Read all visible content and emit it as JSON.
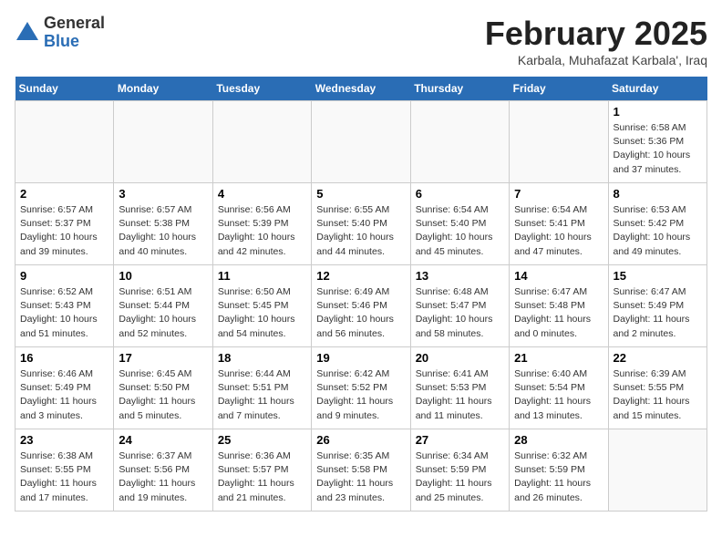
{
  "header": {
    "logo_general": "General",
    "logo_blue": "Blue",
    "title": "February 2025",
    "subtitle": "Karbala, Muhafazat Karbala', Iraq"
  },
  "days_of_week": [
    "Sunday",
    "Monday",
    "Tuesday",
    "Wednesday",
    "Thursday",
    "Friday",
    "Saturday"
  ],
  "weeks": [
    [
      {
        "day": "",
        "empty": true
      },
      {
        "day": "",
        "empty": true
      },
      {
        "day": "",
        "empty": true
      },
      {
        "day": "",
        "empty": true
      },
      {
        "day": "",
        "empty": true
      },
      {
        "day": "",
        "empty": true
      },
      {
        "day": "1",
        "sunrise": "Sunrise: 6:58 AM",
        "sunset": "Sunset: 5:36 PM",
        "daylight": "Daylight: 10 hours and 37 minutes."
      }
    ],
    [
      {
        "day": "2",
        "sunrise": "Sunrise: 6:57 AM",
        "sunset": "Sunset: 5:37 PM",
        "daylight": "Daylight: 10 hours and 39 minutes."
      },
      {
        "day": "3",
        "sunrise": "Sunrise: 6:57 AM",
        "sunset": "Sunset: 5:38 PM",
        "daylight": "Daylight: 10 hours and 40 minutes."
      },
      {
        "day": "4",
        "sunrise": "Sunrise: 6:56 AM",
        "sunset": "Sunset: 5:39 PM",
        "daylight": "Daylight: 10 hours and 42 minutes."
      },
      {
        "day": "5",
        "sunrise": "Sunrise: 6:55 AM",
        "sunset": "Sunset: 5:40 PM",
        "daylight": "Daylight: 10 hours and 44 minutes."
      },
      {
        "day": "6",
        "sunrise": "Sunrise: 6:54 AM",
        "sunset": "Sunset: 5:40 PM",
        "daylight": "Daylight: 10 hours and 45 minutes."
      },
      {
        "day": "7",
        "sunrise": "Sunrise: 6:54 AM",
        "sunset": "Sunset: 5:41 PM",
        "daylight": "Daylight: 10 hours and 47 minutes."
      },
      {
        "day": "8",
        "sunrise": "Sunrise: 6:53 AM",
        "sunset": "Sunset: 5:42 PM",
        "daylight": "Daylight: 10 hours and 49 minutes."
      }
    ],
    [
      {
        "day": "9",
        "sunrise": "Sunrise: 6:52 AM",
        "sunset": "Sunset: 5:43 PM",
        "daylight": "Daylight: 10 hours and 51 minutes."
      },
      {
        "day": "10",
        "sunrise": "Sunrise: 6:51 AM",
        "sunset": "Sunset: 5:44 PM",
        "daylight": "Daylight: 10 hours and 52 minutes."
      },
      {
        "day": "11",
        "sunrise": "Sunrise: 6:50 AM",
        "sunset": "Sunset: 5:45 PM",
        "daylight": "Daylight: 10 hours and 54 minutes."
      },
      {
        "day": "12",
        "sunrise": "Sunrise: 6:49 AM",
        "sunset": "Sunset: 5:46 PM",
        "daylight": "Daylight: 10 hours and 56 minutes."
      },
      {
        "day": "13",
        "sunrise": "Sunrise: 6:48 AM",
        "sunset": "Sunset: 5:47 PM",
        "daylight": "Daylight: 10 hours and 58 minutes."
      },
      {
        "day": "14",
        "sunrise": "Sunrise: 6:47 AM",
        "sunset": "Sunset: 5:48 PM",
        "daylight": "Daylight: 11 hours and 0 minutes."
      },
      {
        "day": "15",
        "sunrise": "Sunrise: 6:47 AM",
        "sunset": "Sunset: 5:49 PM",
        "daylight": "Daylight: 11 hours and 2 minutes."
      }
    ],
    [
      {
        "day": "16",
        "sunrise": "Sunrise: 6:46 AM",
        "sunset": "Sunset: 5:49 PM",
        "daylight": "Daylight: 11 hours and 3 minutes."
      },
      {
        "day": "17",
        "sunrise": "Sunrise: 6:45 AM",
        "sunset": "Sunset: 5:50 PM",
        "daylight": "Daylight: 11 hours and 5 minutes."
      },
      {
        "day": "18",
        "sunrise": "Sunrise: 6:44 AM",
        "sunset": "Sunset: 5:51 PM",
        "daylight": "Daylight: 11 hours and 7 minutes."
      },
      {
        "day": "19",
        "sunrise": "Sunrise: 6:42 AM",
        "sunset": "Sunset: 5:52 PM",
        "daylight": "Daylight: 11 hours and 9 minutes."
      },
      {
        "day": "20",
        "sunrise": "Sunrise: 6:41 AM",
        "sunset": "Sunset: 5:53 PM",
        "daylight": "Daylight: 11 hours and 11 minutes."
      },
      {
        "day": "21",
        "sunrise": "Sunrise: 6:40 AM",
        "sunset": "Sunset: 5:54 PM",
        "daylight": "Daylight: 11 hours and 13 minutes."
      },
      {
        "day": "22",
        "sunrise": "Sunrise: 6:39 AM",
        "sunset": "Sunset: 5:55 PM",
        "daylight": "Daylight: 11 hours and 15 minutes."
      }
    ],
    [
      {
        "day": "23",
        "sunrise": "Sunrise: 6:38 AM",
        "sunset": "Sunset: 5:55 PM",
        "daylight": "Daylight: 11 hours and 17 minutes."
      },
      {
        "day": "24",
        "sunrise": "Sunrise: 6:37 AM",
        "sunset": "Sunset: 5:56 PM",
        "daylight": "Daylight: 11 hours and 19 minutes."
      },
      {
        "day": "25",
        "sunrise": "Sunrise: 6:36 AM",
        "sunset": "Sunset: 5:57 PM",
        "daylight": "Daylight: 11 hours and 21 minutes."
      },
      {
        "day": "26",
        "sunrise": "Sunrise: 6:35 AM",
        "sunset": "Sunset: 5:58 PM",
        "daylight": "Daylight: 11 hours and 23 minutes."
      },
      {
        "day": "27",
        "sunrise": "Sunrise: 6:34 AM",
        "sunset": "Sunset: 5:59 PM",
        "daylight": "Daylight: 11 hours and 25 minutes."
      },
      {
        "day": "28",
        "sunrise": "Sunrise: 6:32 AM",
        "sunset": "Sunset: 5:59 PM",
        "daylight": "Daylight: 11 hours and 26 minutes."
      },
      {
        "day": "",
        "empty": true
      }
    ]
  ]
}
